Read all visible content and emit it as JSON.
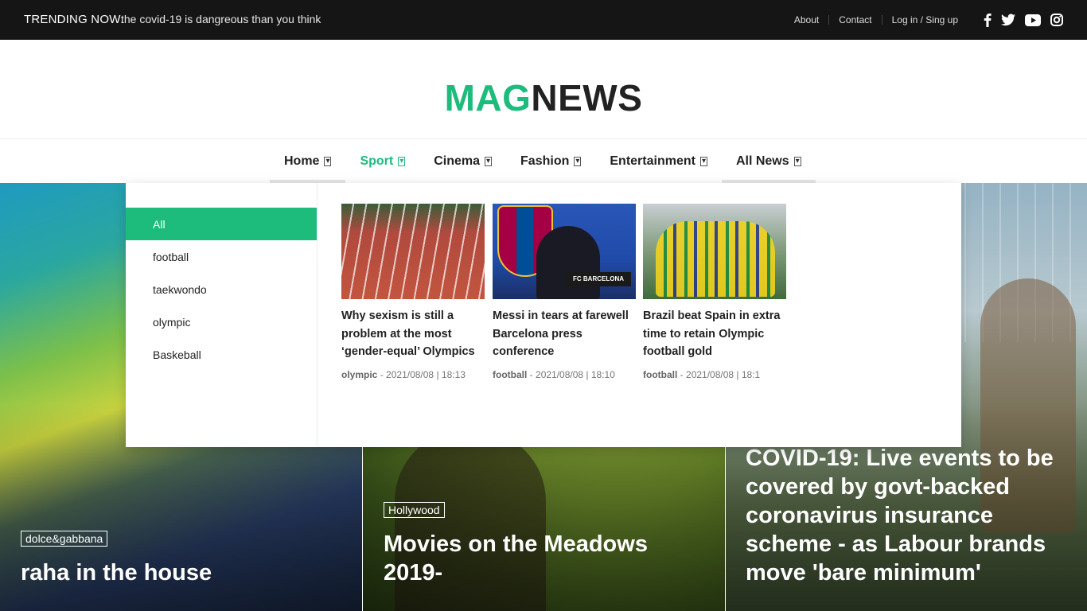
{
  "topbar": {
    "trending_label": "TRENDING NOW:",
    "trending_text": "the covid-19 is dangreous than you think",
    "links": [
      "About",
      "Contact",
      "Log in / Sing up"
    ],
    "social_icons": [
      "facebook-icon",
      "twitter-icon",
      "youtube-icon",
      "instagram-icon"
    ]
  },
  "logo": {
    "part1": "MAG",
    "part2": "NEWS",
    "accent_color": "#1ebc7c"
  },
  "nav": {
    "items": [
      {
        "label": "Home",
        "icon": "chevron-down-icon"
      },
      {
        "label": "Sport",
        "icon": "chevron-down-icon"
      },
      {
        "label": "Cinema",
        "icon": "chevron-down-icon"
      },
      {
        "label": "Fashion",
        "icon": "chevron-down-icon"
      },
      {
        "label": "Entertainment",
        "icon": "chevron-down-icon"
      },
      {
        "label": "All News",
        "icon": "chevron-down-icon"
      }
    ],
    "active": "Sport"
  },
  "mega_menu": {
    "categories": [
      "All",
      "football",
      "taekwondo",
      "olympic",
      "Baskeball"
    ],
    "active_category": "All",
    "cards": [
      {
        "title": "Why sexism is still a problem at the most ‘gender-equal’ Olympics",
        "category": "olympic",
        "date": "2021/08/08 | 18:13"
      },
      {
        "title": "Messi in tears at farewell Barcelona press conference",
        "category": "football",
        "date": "2021/08/08 | 18:10",
        "thumb_sign": "FC BARCELONA"
      },
      {
        "title": "Brazil beat Spain in extra time to retain Olympic football gold",
        "category": "football",
        "date": "2021/08/08 | 18:1"
      }
    ],
    "meta_separator": "-"
  },
  "hero": [
    {
      "tag": "dolce&gabbana",
      "title": "raha in the house"
    },
    {
      "tag": "Hollywood",
      "title": "Movies on the Meadows 2019-"
    },
    {
      "title": "COVID-19: Live events to be covered by govt-backed coronavirus insurance scheme - as Labour brands move 'bare minimum'"
    }
  ]
}
